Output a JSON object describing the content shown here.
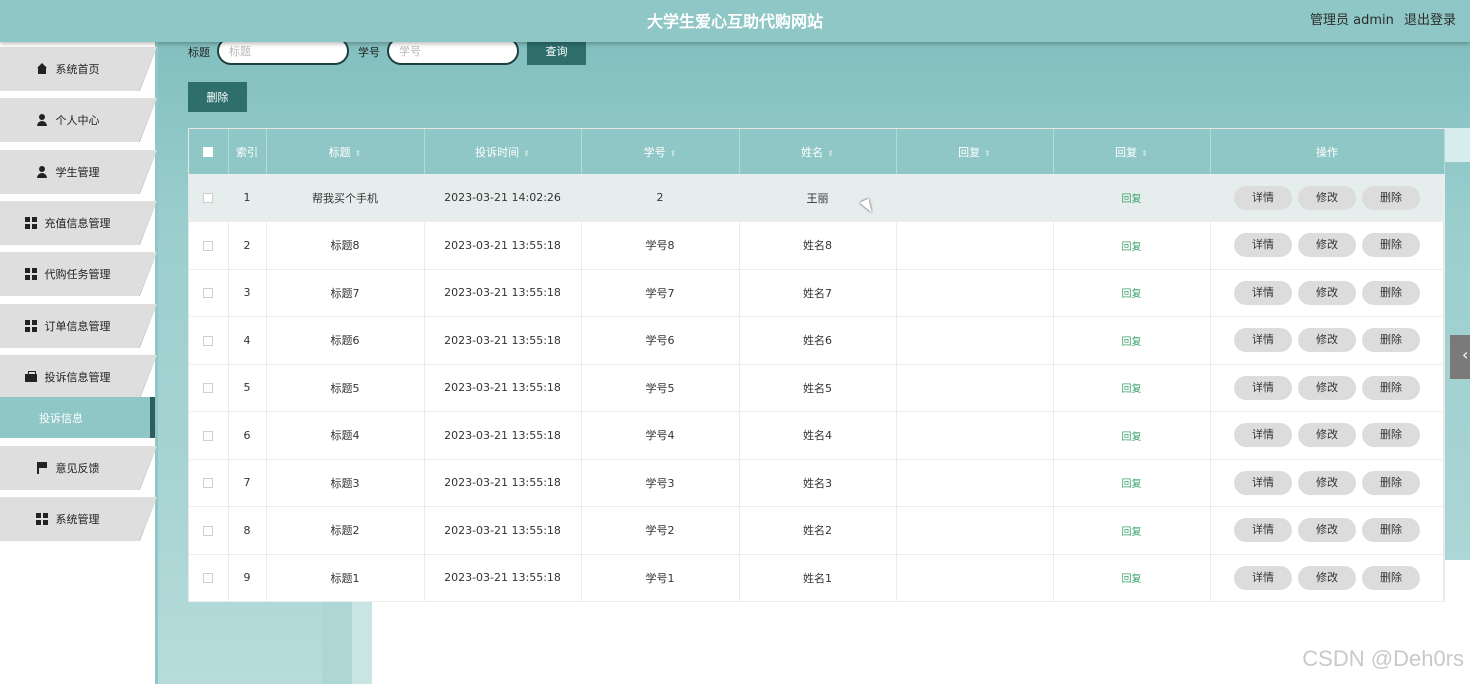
{
  "header": {
    "title": "大学生爱心互助代购网站",
    "role": "管理员 admin",
    "logout": "退出登录"
  },
  "sidebar": {
    "items": [
      {
        "label": "系统首页",
        "icon": "home-icon"
      },
      {
        "label": "个人中心",
        "icon": "user-icon"
      },
      {
        "label": "学生管理",
        "icon": "user-icon"
      },
      {
        "label": "充值信息管理",
        "icon": "grid-icon"
      },
      {
        "label": "代购任务管理",
        "icon": "grid-icon"
      },
      {
        "label": "订单信息管理",
        "icon": "grid-icon"
      },
      {
        "label": "投诉信息管理",
        "icon": "briefcase-icon"
      },
      {
        "label": "意见反馈",
        "icon": "flag-icon"
      },
      {
        "label": "系统管理",
        "icon": "grid-icon"
      }
    ],
    "active_sub": "投诉信息"
  },
  "search": {
    "title_label": "标题",
    "title_placeholder": "标题",
    "title_value": "",
    "student_no_label": "学号",
    "student_no_placeholder": "学号",
    "student_no_value": "",
    "query_button": "查询"
  },
  "toolbar": {
    "delete_button": "删除"
  },
  "table": {
    "columns": [
      "索引",
      "标题",
      "投诉时间",
      "学号",
      "姓名",
      "回复",
      "回复",
      "操作"
    ],
    "reply_link": "回复",
    "actions": [
      "详情",
      "修改",
      "删除"
    ],
    "rows": [
      {
        "index": "1",
        "title": "帮我买个手机",
        "time": "2023-03-21 14:02:26",
        "student_no": "2",
        "name": "王丽",
        "reply": ""
      },
      {
        "index": "2",
        "title": "标题8",
        "time": "2023-03-21 13:55:18",
        "student_no": "学号8",
        "name": "姓名8",
        "reply": ""
      },
      {
        "index": "3",
        "title": "标题7",
        "time": "2023-03-21 13:55:18",
        "student_no": "学号7",
        "name": "姓名7",
        "reply": ""
      },
      {
        "index": "4",
        "title": "标题6",
        "time": "2023-03-21 13:55:18",
        "student_no": "学号6",
        "name": "姓名6",
        "reply": ""
      },
      {
        "index": "5",
        "title": "标题5",
        "time": "2023-03-21 13:55:18",
        "student_no": "学号5",
        "name": "姓名5",
        "reply": ""
      },
      {
        "index": "6",
        "title": "标题4",
        "time": "2023-03-21 13:55:18",
        "student_no": "学号4",
        "name": "姓名4",
        "reply": ""
      },
      {
        "index": "7",
        "title": "标题3",
        "time": "2023-03-21 13:55:18",
        "student_no": "学号3",
        "name": "姓名3",
        "reply": ""
      },
      {
        "index": "8",
        "title": "标题2",
        "time": "2023-03-21 13:55:18",
        "student_no": "学号2",
        "name": "姓名2",
        "reply": ""
      },
      {
        "index": "9",
        "title": "标题1",
        "time": "2023-03-21 13:55:18",
        "student_no": "学号1",
        "name": "姓名1",
        "reply": ""
      }
    ]
  },
  "watermark": "CSDN @Deh0rs",
  "colors": {
    "accent": "#8fc7c6",
    "dark_button": "#2e6f6c",
    "reply_link": "#3aa36b"
  }
}
